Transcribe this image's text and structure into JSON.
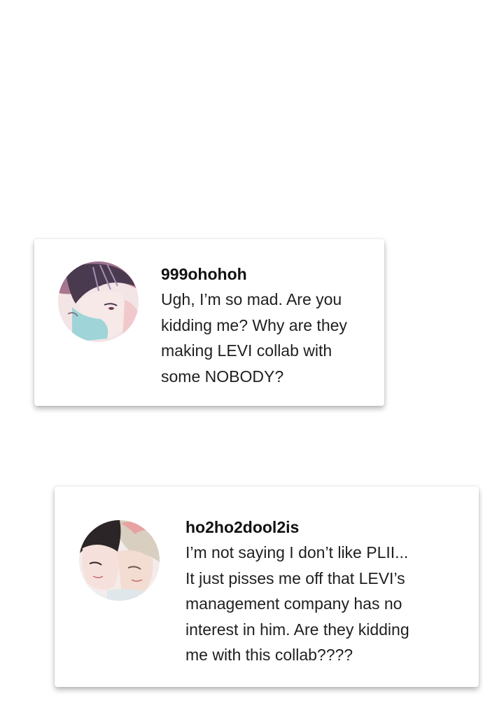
{
  "comments": [
    {
      "username": "999ohohoh",
      "lines": [
        "Ugh, I’m so mad. Are you",
        "kidding me? Why are they",
        "making LEVI collab with",
        "some NOBODY?"
      ],
      "avatar_icon": "manga-profile-avatar"
    },
    {
      "username": "ho2ho2dool2is",
      "lines": [
        "I’m not saying I don’t like PLII...",
        "It just pisses me off that LEVI’s",
        "management company has no",
        "interest in him. Are they kidding",
        "me with this collab????"
      ],
      "avatar_icon": "manga-duo-profile-avatar"
    }
  ],
  "colors": {
    "background": "#ffffff",
    "card": "#ffffff",
    "text": "#1f1f1f"
  }
}
